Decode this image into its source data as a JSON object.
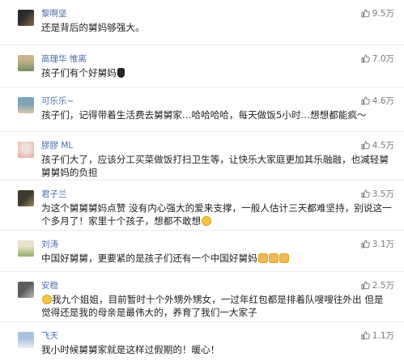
{
  "colors": {
    "username": "#4a6ea9",
    "text": "#222222",
    "likes": "#7a7a7a",
    "divider": "#ececec"
  },
  "comments": [
    {
      "username": "黎啊坚",
      "text": "还是背后的舅妈够强大。",
      "likes": "9.5万",
      "avatar_colors": [
        "#2b2b2b",
        "#8a6a4a"
      ]
    },
    {
      "username": "高理华 惟离",
      "text": "孩子们有个好舅妈",
      "likes": "7.0万",
      "avatar_colors": [
        "#6f8f5e",
        "#c8b48c"
      ]
    },
    {
      "username": "可乐乐~",
      "text": "孩子们，记得带着生活费去舅舅家…哈哈哈哈，每天做饭5小时…想想都能疯～",
      "likes": "4.6万",
      "avatar_colors": [
        "#7fa3b8",
        "#d8c9a8"
      ]
    },
    {
      "username": "膠膠 ML",
      "text": "孩子们大了，应该分工买菜做饭打扫卫生等，让快乐大家庭更加其乐融融，也减轻舅舅舅妈的负担",
      "likes": "4.5万",
      "avatar_colors": [
        "#e6a6a0",
        "#f2e0d6"
      ]
    },
    {
      "username": "君子兰",
      "text": "为这个舅舅舅妈点赞 没有内心强大的爱来支撑，一般人估计三天都难坚持，别说这一个多月了！家里十个孩子，想都不敢想",
      "likes": "3.5万",
      "avatar_colors": [
        "#3d3a2e",
        "#9c8a5a"
      ]
    },
    {
      "username": "刘涛",
      "text": "中国好舅舅，更要紧的是孩子们还有一个中国好舅妈",
      "likes": "3.1万",
      "avatar_colors": [
        "#8fae6b",
        "#e9e4c9"
      ]
    },
    {
      "username": "安稳",
      "text": "我九个姐姐，目前暂时十个外甥外甥女，一过年红包都是排着队嗖嗖往外出 但是觉得还是我的母亲是最伟大的，养育了我们一大家子",
      "likes": "2.5万",
      "avatar_colors": [
        "#5b5b5b",
        "#b9b9b9"
      ]
    },
    {
      "username": "飞天",
      "text": "我小时候舅舅家就是这样过假期的！暖心！",
      "likes": "1.1万",
      "avatar_colors": [
        "#a8c4e0",
        "#e8eef5"
      ]
    }
  ]
}
